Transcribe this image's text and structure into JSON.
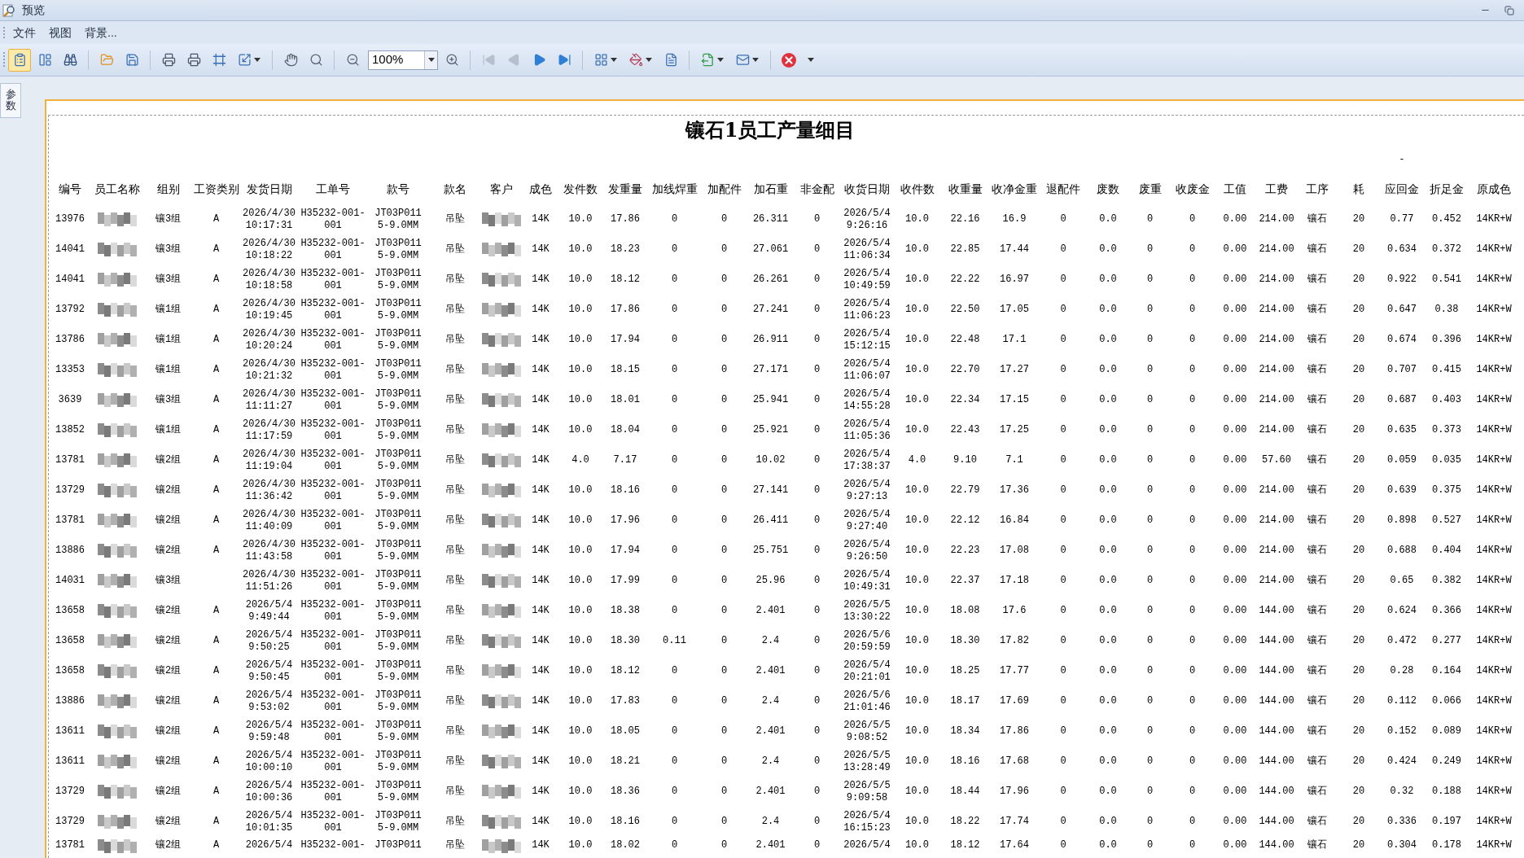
{
  "window": {
    "title": "预览"
  },
  "menu": [
    "文件",
    "视图",
    "背景..."
  ],
  "toolbar": [
    {
      "kind": "button",
      "selected": true,
      "disabled": false
    },
    {
      "kind": "button",
      "selected": false,
      "disabled": false
    },
    {
      "kind": "button",
      "selected": false,
      "disabled": false
    },
    {
      "kind": "separator"
    },
    {
      "kind": "button",
      "selected": false,
      "disabled": false
    },
    {
      "kind": "button",
      "selected": false,
      "disabled": false
    },
    {
      "kind": "separator"
    },
    {
      "kind": "button",
      "selected": false,
      "disabled": false
    },
    {
      "kind": "button",
      "selected": false,
      "disabled": false
    },
    {
      "kind": "button",
      "selected": false,
      "disabled": false
    },
    {
      "kind": "dropdown",
      "selected": false,
      "disabled": false
    },
    {
      "kind": "separator"
    },
    {
      "kind": "button",
      "selected": false,
      "disabled": false
    },
    {
      "kind": "button",
      "selected": false,
      "disabled": false
    },
    {
      "kind": "separator"
    },
    {
      "kind": "button",
      "selected": false,
      "disabled": false
    },
    {
      "kind": "zoom",
      "value": "100%"
    },
    {
      "kind": "button",
      "selected": false,
      "disabled": false
    },
    {
      "kind": "separator"
    },
    {
      "kind": "button",
      "selected": false,
      "disabled": true
    },
    {
      "kind": "button",
      "selected": false,
      "disabled": true
    },
    {
      "kind": "button",
      "selected": false,
      "disabled": false
    },
    {
      "kind": "button",
      "selected": false,
      "disabled": false
    },
    {
      "kind": "separator"
    },
    {
      "kind": "dropdown",
      "selected": false,
      "disabled": false
    },
    {
      "kind": "dropdown",
      "selected": false,
      "disabled": false
    },
    {
      "kind": "button",
      "selected": false,
      "disabled": false
    },
    {
      "kind": "separator"
    },
    {
      "kind": "dropdown",
      "selected": false,
      "disabled": false
    },
    {
      "kind": "dropdown",
      "selected": false,
      "disabled": false
    },
    {
      "kind": "separator"
    },
    {
      "kind": "button",
      "selected": false,
      "disabled": false
    },
    {
      "kind": "overflow"
    }
  ],
  "side_panel_tab": {
    "label": "参数"
  },
  "report": {
    "title": "镶石1员工产量细目",
    "columns": [
      {
        "label": "编号"
      },
      {
        "label": "员工名称",
        "kind": "redacted"
      },
      {
        "label": "组别"
      },
      {
        "label": "工资类别"
      },
      {
        "label": "发货日期"
      },
      {
        "label": "工单号"
      },
      {
        "label": "款号"
      },
      {
        "label": "款名"
      },
      {
        "label": "客户",
        "kind": "redacted"
      },
      {
        "label": "成色"
      },
      {
        "label": "发件数"
      },
      {
        "label": "发重量"
      },
      {
        "label": "加线焊重"
      },
      {
        "label": "加配件"
      },
      {
        "label": "加石重"
      },
      {
        "label": "非金配"
      },
      {
        "label": "收货日期"
      },
      {
        "label": "收件数"
      },
      {
        "label": "收重量"
      },
      {
        "label": "收净金重"
      },
      {
        "label": "退配件"
      },
      {
        "label": "废数"
      },
      {
        "label": "废重"
      },
      {
        "label": "收废金"
      },
      {
        "label": "工值"
      },
      {
        "label": "工费"
      },
      {
        "label": "工序"
      },
      {
        "label": "耗"
      },
      {
        "label": "应回金",
        "mark": "-"
      },
      {
        "label": "折足金"
      },
      {
        "label": "原成色"
      }
    ],
    "rows": [
      [
        "13976",
        null,
        "镶3组",
        "A",
        [
          "2026/4/30",
          "10:17:31"
        ],
        [
          "H35232-001-",
          "001"
        ],
        [
          "JT03P011",
          "5-9.0MM"
        ],
        "吊坠",
        null,
        "14K",
        "10.0",
        "17.86",
        "0",
        "0",
        "26.311",
        "0",
        [
          "2026/5/4",
          "9:26:16"
        ],
        "10.0",
        "22.16",
        "16.9",
        "0",
        "0.0",
        "0",
        "0",
        "0.00",
        "214.00",
        "镶石",
        "20",
        "0.77",
        "0.452",
        "14KR+W"
      ],
      [
        "14041",
        null,
        "镶3组",
        "A",
        [
          "2026/4/30",
          "10:18:22"
        ],
        [
          "H35232-001-",
          "001"
        ],
        [
          "JT03P011",
          "5-9.0MM"
        ],
        "吊坠",
        null,
        "14K",
        "10.0",
        "18.23",
        "0",
        "0",
        "27.061",
        "0",
        [
          "2026/5/4",
          "11:06:34"
        ],
        "10.0",
        "22.85",
        "17.44",
        "0",
        "0.0",
        "0",
        "0",
        "0.00",
        "214.00",
        "镶石",
        "20",
        "0.634",
        "0.372",
        "14KR+W"
      ],
      [
        "14041",
        null,
        "镶3组",
        "A",
        [
          "2026/4/30",
          "10:18:58"
        ],
        [
          "H35232-001-",
          "001"
        ],
        [
          "JT03P011",
          "5-9.0MM"
        ],
        "吊坠",
        null,
        "14K",
        "10.0",
        "18.12",
        "0",
        "0",
        "26.261",
        "0",
        [
          "2026/5/4",
          "10:49:59"
        ],
        "10.0",
        "22.22",
        "16.97",
        "0",
        "0.0",
        "0",
        "0",
        "0.00",
        "214.00",
        "镶石",
        "20",
        "0.922",
        "0.541",
        "14KR+W"
      ],
      [
        "13792",
        null,
        "镶1组",
        "A",
        [
          "2026/4/30",
          "10:19:45"
        ],
        [
          "H35232-001-",
          "001"
        ],
        [
          "JT03P011",
          "5-9.0MM"
        ],
        "吊坠",
        null,
        "14K",
        "10.0",
        "17.86",
        "0",
        "0",
        "27.241",
        "0",
        [
          "2026/5/4",
          "11:06:23"
        ],
        "10.0",
        "22.50",
        "17.05",
        "0",
        "0.0",
        "0",
        "0",
        "0.00",
        "214.00",
        "镶石",
        "20",
        "0.647",
        "0.38",
        "14KR+W"
      ],
      [
        "13786",
        null,
        "镶1组",
        "A",
        [
          "2026/4/30",
          "10:20:24"
        ],
        [
          "H35232-001-",
          "001"
        ],
        [
          "JT03P011",
          "5-9.0MM"
        ],
        "吊坠",
        null,
        "14K",
        "10.0",
        "17.94",
        "0",
        "0",
        "26.911",
        "0",
        [
          "2026/5/4",
          "15:12:15"
        ],
        "10.0",
        "22.48",
        "17.1",
        "0",
        "0.0",
        "0",
        "0",
        "0.00",
        "214.00",
        "镶石",
        "20",
        "0.674",
        "0.396",
        "14KR+W"
      ],
      [
        "13353",
        null,
        "镶1组",
        "A",
        [
          "2026/4/30",
          "10:21:32"
        ],
        [
          "H35232-001-",
          "001"
        ],
        [
          "JT03P011",
          "5-9.0MM"
        ],
        "吊坠",
        null,
        "14K",
        "10.0",
        "18.15",
        "0",
        "0",
        "27.171",
        "0",
        [
          "2026/5/4",
          "11:06:07"
        ],
        "10.0",
        "22.70",
        "17.27",
        "0",
        "0.0",
        "0",
        "0",
        "0.00",
        "214.00",
        "镶石",
        "20",
        "0.707",
        "0.415",
        "14KR+W"
      ],
      [
        "3639",
        null,
        "镶3组",
        "A",
        [
          "2026/4/30",
          "11:11:27"
        ],
        [
          "H35232-001-",
          "001"
        ],
        [
          "JT03P011",
          "5-9.0MM"
        ],
        "吊坠",
        null,
        "14K",
        "10.0",
        "18.01",
        "0",
        "0",
        "25.941",
        "0",
        [
          "2026/5/4",
          "14:55:28"
        ],
        "10.0",
        "22.34",
        "17.15",
        "0",
        "0.0",
        "0",
        "0",
        "0.00",
        "214.00",
        "镶石",
        "20",
        "0.687",
        "0.403",
        "14KR+W"
      ],
      [
        "13852",
        null,
        "镶1组",
        "A",
        [
          "2026/4/30",
          "11:17:59"
        ],
        [
          "H35232-001-",
          "001"
        ],
        [
          "JT03P011",
          "5-9.0MM"
        ],
        "吊坠",
        null,
        "14K",
        "10.0",
        "18.04",
        "0",
        "0",
        "25.921",
        "0",
        [
          "2026/5/4",
          "11:05:36"
        ],
        "10.0",
        "22.43",
        "17.25",
        "0",
        "0.0",
        "0",
        "0",
        "0.00",
        "214.00",
        "镶石",
        "20",
        "0.635",
        "0.373",
        "14KR+W"
      ],
      [
        "13781",
        null,
        "镶2组",
        "A",
        [
          "2026/4/30",
          "11:19:04"
        ],
        [
          "H35232-001-",
          "001"
        ],
        [
          "JT03P011",
          "5-9.0MM"
        ],
        "吊坠",
        null,
        "14K",
        "4.0",
        "7.17",
        "0",
        "0",
        "10.02",
        "0",
        [
          "2026/5/4",
          "17:38:37"
        ],
        "4.0",
        "9.10",
        "7.1",
        "0",
        "0.0",
        "0",
        "0",
        "0.00",
        "57.60",
        "镶石",
        "20",
        "0.059",
        "0.035",
        "14KR+W"
      ],
      [
        "13729",
        null,
        "镶2组",
        "A",
        [
          "2026/4/30",
          "11:36:42"
        ],
        [
          "H35232-001-",
          "001"
        ],
        [
          "JT03P011",
          "5-9.0MM"
        ],
        "吊坠",
        null,
        "14K",
        "10.0",
        "18.16",
        "0",
        "0",
        "27.141",
        "0",
        [
          "2026/5/4",
          "9:27:13"
        ],
        "10.0",
        "22.79",
        "17.36",
        "0",
        "0.0",
        "0",
        "0",
        "0.00",
        "214.00",
        "镶石",
        "20",
        "0.639",
        "0.375",
        "14KR+W"
      ],
      [
        "13781",
        null,
        "镶2组",
        "A",
        [
          "2026/4/30",
          "11:40:09"
        ],
        [
          "H35232-001-",
          "001"
        ],
        [
          "JT03P011",
          "5-9.0MM"
        ],
        "吊坠",
        null,
        "14K",
        "10.0",
        "17.96",
        "0",
        "0",
        "26.411",
        "0",
        [
          "2026/5/4",
          "9:27:40"
        ],
        "10.0",
        "22.12",
        "16.84",
        "0",
        "0.0",
        "0",
        "0",
        "0.00",
        "214.00",
        "镶石",
        "20",
        "0.898",
        "0.527",
        "14KR+W"
      ],
      [
        "13886",
        null,
        "镶2组",
        "A",
        [
          "2026/4/30",
          "11:43:58"
        ],
        [
          "H35232-001-",
          "001"
        ],
        [
          "JT03P011",
          "5-9.0MM"
        ],
        "吊坠",
        null,
        "14K",
        "10.0",
        "17.94",
        "0",
        "0",
        "25.751",
        "0",
        [
          "2026/5/4",
          "9:26:50"
        ],
        "10.0",
        "22.23",
        "17.08",
        "0",
        "0.0",
        "0",
        "0",
        "0.00",
        "214.00",
        "镶石",
        "20",
        "0.688",
        "0.404",
        "14KR+W"
      ],
      [
        "14031",
        null,
        "镶3组",
        "",
        [
          "2026/4/30",
          "11:51:26"
        ],
        [
          "H35232-001-",
          "001"
        ],
        [
          "JT03P011",
          "5-9.0MM"
        ],
        "吊坠",
        null,
        "14K",
        "10.0",
        "17.99",
        "0",
        "0",
        "25.96",
        "0",
        [
          "2026/5/4",
          "10:49:31"
        ],
        "10.0",
        "22.37",
        "17.18",
        "0",
        "0.0",
        "0",
        "0",
        "0.00",
        "214.00",
        "镶石",
        "20",
        "0.65",
        "0.382",
        "14KR+W"
      ],
      [
        "13658",
        null,
        "镶2组",
        "A",
        [
          "2026/5/4",
          "9:49:44"
        ],
        [
          "H35232-001-",
          "001"
        ],
        [
          "JT03P011",
          "5-9.0MM"
        ],
        "吊坠",
        null,
        "14K",
        "10.0",
        "18.38",
        "0",
        "0",
        "2.401",
        "0",
        [
          "2026/5/5",
          "13:30:22"
        ],
        "10.0",
        "18.08",
        "17.6",
        "0",
        "0.0",
        "0",
        "0",
        "0.00",
        "144.00",
        "镶石",
        "20",
        "0.624",
        "0.366",
        "14KR+W"
      ],
      [
        "13658",
        null,
        "镶2组",
        "A",
        [
          "2026/5/4",
          "9:50:25"
        ],
        [
          "H35232-001-",
          "001"
        ],
        [
          "JT03P011",
          "5-9.0MM"
        ],
        "吊坠",
        null,
        "14K",
        "10.0",
        "18.30",
        "0.11",
        "0",
        "2.4",
        "0",
        [
          "2026/5/6",
          "20:59:59"
        ],
        "10.0",
        "18.30",
        "17.82",
        "0",
        "0.0",
        "0",
        "0",
        "0.00",
        "144.00",
        "镶石",
        "20",
        "0.472",
        "0.277",
        "14KR+W"
      ],
      [
        "13658",
        null,
        "镶2组",
        "A",
        [
          "2026/5/4",
          "9:50:45"
        ],
        [
          "H35232-001-",
          "001"
        ],
        [
          "JT03P011",
          "5-9.0MM"
        ],
        "吊坠",
        null,
        "14K",
        "10.0",
        "18.12",
        "0",
        "0",
        "2.401",
        "0",
        [
          "2026/5/4",
          "20:21:01"
        ],
        "10.0",
        "18.25",
        "17.77",
        "0",
        "0.0",
        "0",
        "0",
        "0.00",
        "144.00",
        "镶石",
        "20",
        "0.28",
        "0.164",
        "14KR+W"
      ],
      [
        "13886",
        null,
        "镶2组",
        "A",
        [
          "2026/5/4",
          "9:53:02"
        ],
        [
          "H35232-001-",
          "001"
        ],
        [
          "JT03P011",
          "5-9.0MM"
        ],
        "吊坠",
        null,
        "14K",
        "10.0",
        "17.83",
        "0",
        "0",
        "2.4",
        "0",
        [
          "2026/5/6",
          "21:01:46"
        ],
        "10.0",
        "18.17",
        "17.69",
        "0",
        "0.0",
        "0",
        "0",
        "0.00",
        "144.00",
        "镶石",
        "20",
        "0.112",
        "0.066",
        "14KR+W"
      ],
      [
        "13611",
        null,
        "镶2组",
        "A",
        [
          "2026/5/4",
          "9:59:48"
        ],
        [
          "H35232-001-",
          "001"
        ],
        [
          "JT03P011",
          "5-9.0MM"
        ],
        "吊坠",
        null,
        "14K",
        "10.0",
        "18.05",
        "0",
        "0",
        "2.401",
        "0",
        [
          "2026/5/5",
          "9:08:52"
        ],
        "10.0",
        "18.34",
        "17.86",
        "0",
        "0.0",
        "0",
        "0",
        "0.00",
        "144.00",
        "镶石",
        "20",
        "0.152",
        "0.089",
        "14KR+W"
      ],
      [
        "13611",
        null,
        "镶2组",
        "A",
        [
          "2026/5/4",
          "10:00:10"
        ],
        [
          "H35232-001-",
          "001"
        ],
        [
          "JT03P011",
          "5-9.0MM"
        ],
        "吊坠",
        null,
        "14K",
        "10.0",
        "18.21",
        "0",
        "0",
        "2.4",
        "0",
        [
          "2026/5/5",
          "13:28:49"
        ],
        "10.0",
        "18.16",
        "17.68",
        "0",
        "0.0",
        "0",
        "0",
        "0.00",
        "144.00",
        "镶石",
        "20",
        "0.424",
        "0.249",
        "14KR+W"
      ],
      [
        "13729",
        null,
        "镶2组",
        "A",
        [
          "2026/5/4",
          "10:00:36"
        ],
        [
          "H35232-001-",
          "001"
        ],
        [
          "JT03P011",
          "5-9.0MM"
        ],
        "吊坠",
        null,
        "14K",
        "10.0",
        "18.36",
        "0",
        "0",
        "2.401",
        "0",
        [
          "2026/5/5",
          "9:09:58"
        ],
        "10.0",
        "18.44",
        "17.96",
        "0",
        "0.0",
        "0",
        "0",
        "0.00",
        "144.00",
        "镶石",
        "20",
        "0.32",
        "0.188",
        "14KR+W"
      ],
      [
        "13729",
        null,
        "镶2组",
        "A",
        [
          "2026/5/4",
          "10:01:35"
        ],
        [
          "H35232-001-",
          "001"
        ],
        [
          "JT03P011",
          "5-9.0MM"
        ],
        "吊坠",
        null,
        "14K",
        "10.0",
        "18.16",
        "0",
        "0",
        "2.4",
        "0",
        [
          "2026/5/4",
          "16:15:23"
        ],
        "10.0",
        "18.22",
        "17.74",
        "0",
        "0.0",
        "0",
        "0",
        "0.00",
        "144.00",
        "镶石",
        "20",
        "0.336",
        "0.197",
        "14KR+W"
      ],
      [
        "13781",
        null,
        "镶2组",
        "A",
        "2026/5/4",
        "H35232-001-",
        "JT03P011",
        "吊坠",
        null,
        "14K",
        "10.0",
        "18.02",
        "0",
        "0",
        "2.401",
        "0",
        "2026/5/4",
        "10.0",
        "18.12",
        "17.64",
        "0",
        "0.0",
        "0",
        "0",
        "0.00",
        "144.00",
        "镶石",
        "20",
        "0.304",
        "0.178",
        "14KR+W"
      ]
    ]
  }
}
